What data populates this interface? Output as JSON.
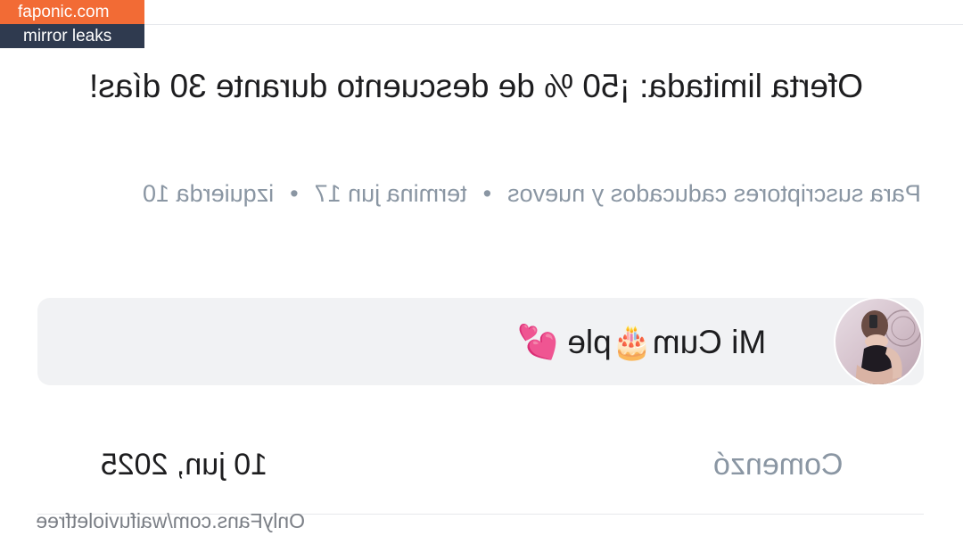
{
  "watermark": {
    "site": "faponic.com",
    "subtitle": "mirror leaks"
  },
  "offer": {
    "title": "Oferta limitada: ¡50 % de descuento durante 30 días!",
    "audience": "Para suscriptores caducados y nuevos",
    "ends": "termina jun 17",
    "remaining": "izquierda 10",
    "separator": "•"
  },
  "card": {
    "title": "Mi Cum🎂ple 💕"
  },
  "started": {
    "label": "Comenzó",
    "value": "10 jun, 2025"
  },
  "footer": {
    "url": "OnlyFans.com/waifuvioletfree"
  },
  "colors": {
    "watermark_top": "#f26b35",
    "watermark_bottom": "#2f3a4f",
    "muted_text": "#8a96a3",
    "card_background": "#f1f2f4"
  }
}
